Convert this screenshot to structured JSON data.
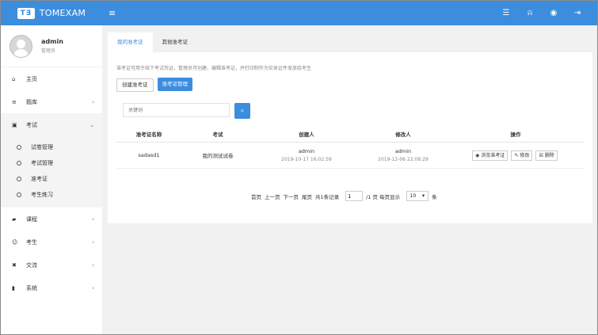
{
  "header": {
    "logo_mark": "T∃",
    "brand": "TOMEXAM",
    "menu_toggle": "≡",
    "icons": [
      {
        "name": "list-icon",
        "glyph": "☰"
      },
      {
        "name": "bell-icon",
        "glyph": "⍾"
      },
      {
        "name": "user-icon",
        "glyph": "◉"
      },
      {
        "name": "logout-icon",
        "glyph": "⇥"
      }
    ]
  },
  "user": {
    "name": "admin",
    "role": "管理员"
  },
  "sidebar": {
    "items": [
      {
        "label": "主页",
        "icon": "⌂"
      },
      {
        "label": "题库",
        "icon": "≡",
        "chevron": "›"
      },
      {
        "label": "考试",
        "icon": "▣",
        "chevron": "⌄"
      },
      {
        "label": "课程",
        "icon": "▰",
        "chevron": "›"
      },
      {
        "label": "考生",
        "icon": "☺",
        "chevron": "›"
      },
      {
        "label": "交流",
        "icon": "✖",
        "chevron": "›"
      },
      {
        "label": "系统",
        "icon": "▮",
        "chevron": "›"
      }
    ],
    "exam_sub": [
      "试卷管理",
      "考试管理",
      "准考证",
      "考生练习"
    ]
  },
  "tabs": [
    "我的准考证",
    "其他准考证"
  ],
  "description": "准考证可用于线下考试凭证，管理员可创建、编辑准考证，并打印制作为实体证件发放给考生",
  "buttons": {
    "create": "创建准考证",
    "manage": "准考证管理"
  },
  "search": {
    "placeholder": "关键词",
    "icon": "⌕"
  },
  "table": {
    "headers": [
      "准考证名称",
      "考试",
      "创建人",
      "修改人",
      "操作"
    ],
    "rows": [
      {
        "name": "sadasd1",
        "exam": "我的测试试卷",
        "creator": "admin",
        "created": "2019-10-17 16:02:59",
        "modifier": "admin",
        "modified": "2019-12-06 22:08:29",
        "actions": [
          {
            "icon": "◉",
            "label": "浏览准考证"
          },
          {
            "icon": "✎",
            "label": "修改"
          },
          {
            "icon": "☒",
            "label": "删除"
          }
        ]
      }
    ]
  },
  "pager": {
    "first": "首页",
    "prev": "上一页",
    "next": "下一页",
    "last": "尾页",
    "total": "共1条记录",
    "page": "1",
    "pages": "/1 页 每页显示",
    "size": "10",
    "unit": "条"
  },
  "colors": {
    "primary": "#3c8dde",
    "content_bg": "#f1f1f1"
  }
}
